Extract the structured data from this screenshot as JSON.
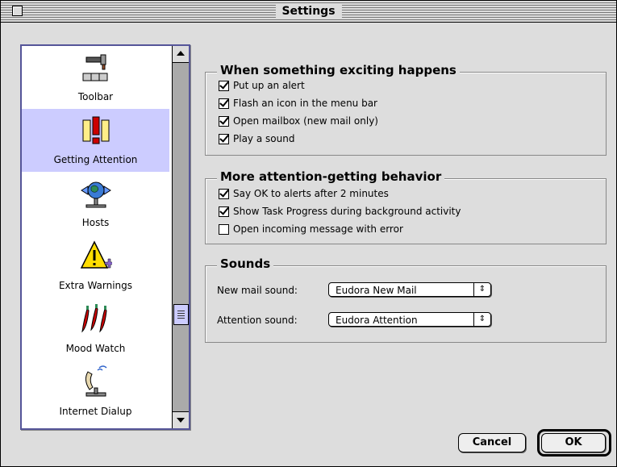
{
  "window": {
    "title": "Settings"
  },
  "sidebar": {
    "items": [
      {
        "label": "Toolbar",
        "icon": "hammer-toolbar-icon",
        "selected": false
      },
      {
        "label": "Getting Attention",
        "icon": "alert-exclamation-icon",
        "selected": true
      },
      {
        "label": "Hosts",
        "icon": "globe-hosts-icon",
        "selected": false
      },
      {
        "label": "Extra Warnings",
        "icon": "warning-triangle-icon",
        "selected": false
      },
      {
        "label": "Mood Watch",
        "icon": "chili-peppers-icon",
        "selected": false
      },
      {
        "label": "Internet Dialup",
        "icon": "telephone-icon",
        "selected": false
      }
    ]
  },
  "exciting": {
    "title": "When something exciting happens",
    "options": [
      {
        "label": "Put up an alert",
        "checked": true
      },
      {
        "label": "Flash an icon in the menu bar",
        "checked": true
      },
      {
        "label": "Open mailbox (new mail only)",
        "checked": true
      },
      {
        "label": "Play a sound",
        "checked": true
      }
    ]
  },
  "attention": {
    "title": "More attention-getting behavior",
    "options": [
      {
        "label": "Say OK to alerts after 2 minutes",
        "checked": true
      },
      {
        "label": "Show Task Progress during background activity",
        "checked": true
      },
      {
        "label": "Open incoming message with error",
        "checked": false
      }
    ]
  },
  "sounds": {
    "title": "Sounds",
    "new_mail_label": "New mail sound:",
    "new_mail_value": "Eudora New Mail",
    "attention_label": "Attention sound:",
    "attention_value": "Eudora Attention"
  },
  "buttons": {
    "cancel": "Cancel",
    "ok": "OK"
  },
  "colors": {
    "selection": "#ccccff",
    "frame": "#555599",
    "window_bg": "#dddddd"
  }
}
